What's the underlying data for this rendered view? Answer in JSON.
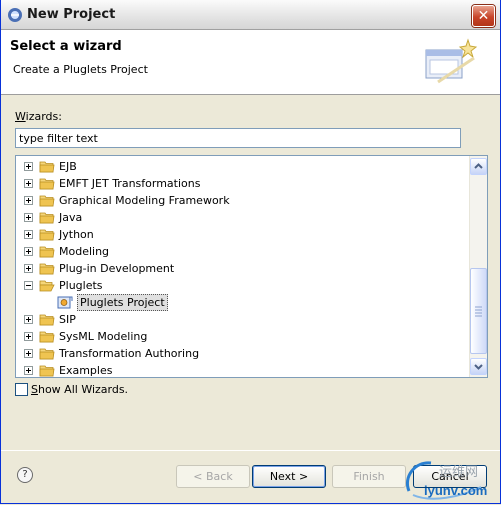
{
  "window": {
    "title": "New Project",
    "close_glyph": "✕"
  },
  "header": {
    "title": "Select a wizard",
    "description": "Create a Pluglets Project"
  },
  "wizards": {
    "label_prefix": "W",
    "label_rest": "izards:",
    "filter_value": "type filter text"
  },
  "tree": {
    "items": [
      {
        "label": "EJB",
        "expanded": false
      },
      {
        "label": "EMFT JET Transformations",
        "expanded": false
      },
      {
        "label": "Graphical Modeling Framework",
        "expanded": false
      },
      {
        "label": "Java",
        "expanded": false
      },
      {
        "label": "Jython",
        "expanded": false
      },
      {
        "label": "Modeling",
        "expanded": false
      },
      {
        "label": "Plug-in Development",
        "expanded": false
      },
      {
        "label": "Pluglets",
        "expanded": true
      },
      {
        "label": "Pluglets Project",
        "child": true,
        "selected": true
      },
      {
        "label": "SIP",
        "expanded": false
      },
      {
        "label": "SysML Modeling",
        "expanded": false
      },
      {
        "label": "Transformation Authoring",
        "expanded": false
      },
      {
        "label": "Examples",
        "expanded": false
      }
    ]
  },
  "show_all": {
    "prefix": "S",
    "rest": "how All Wizards."
  },
  "buttons": {
    "help": "?",
    "back": "< Back",
    "next": "Next >",
    "finish": "Finish",
    "cancel": "Cancel"
  },
  "watermark": {
    "site": "iyunv.com",
    "cn": "运维网"
  },
  "colors": {
    "folder": "#e8c25a",
    "titlebar_close": "#c8452a",
    "link_blue": "#1a6bbf"
  }
}
